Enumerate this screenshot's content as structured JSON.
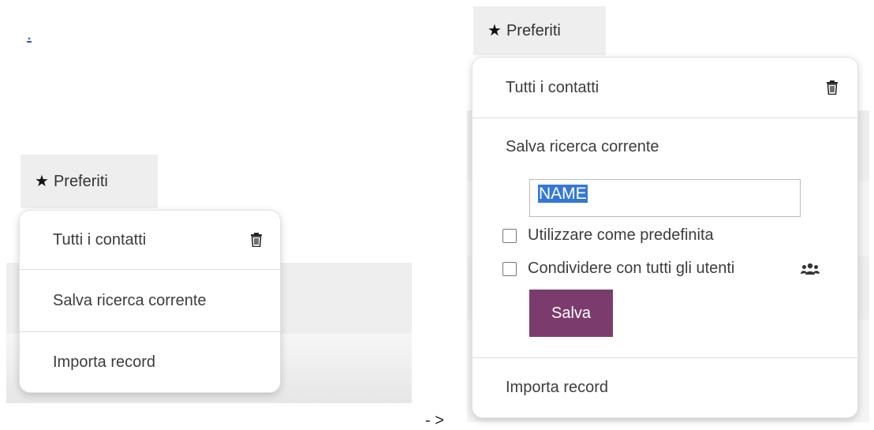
{
  "left": {
    "link_text": ".",
    "favorites_label": "Preferiti",
    "menu": {
      "all_contacts": "Tutti i contatti",
      "save_search": "Salva ricerca corrente",
      "import_records": "Importa record"
    }
  },
  "transition_arrow": "- >",
  "right": {
    "favorites_label": "Preferiti",
    "menu": {
      "all_contacts": "Tutti i contatti",
      "save_search": "Salva ricerca corrente",
      "name_value": "NAME",
      "use_default_label": "Utilizzare come predefinita",
      "share_label": "Condividere con tutti gli utenti",
      "save_button": "Salva",
      "import_records": "Importa record"
    }
  },
  "icons": {
    "star": "star-icon",
    "trash": "trash-icon",
    "users": "users-icon"
  },
  "colors": {
    "accent_button": "#7c3b6d",
    "selection": "#3478d6",
    "link": "#2b56d8"
  }
}
